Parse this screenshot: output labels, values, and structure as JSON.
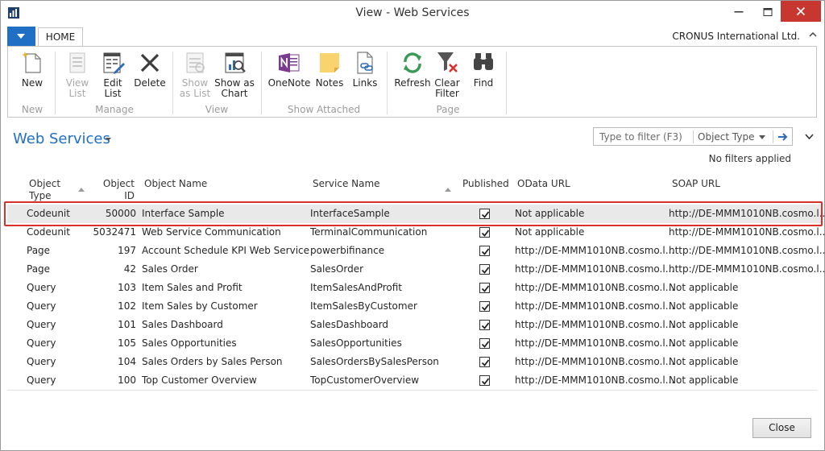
{
  "window": {
    "title": "View - Web Services"
  },
  "ribbon": {
    "tab": "HOME",
    "company": "CRONUS International Ltd.",
    "groups": [
      {
        "label": "New"
      },
      {
        "label": "Manage"
      },
      {
        "label": "View"
      },
      {
        "label": "Show Attached"
      },
      {
        "label": "Page"
      }
    ],
    "buttons": {
      "new": {
        "l1": "New",
        "l2": "",
        "icon": "new-document-icon"
      },
      "view_list": {
        "l1": "View",
        "l2": "List",
        "icon": "view-list-icon"
      },
      "edit_list": {
        "l1": "Edit",
        "l2": "List",
        "icon": "edit-list-icon"
      },
      "delete": {
        "l1": "Delete",
        "l2": "",
        "icon": "delete-x-icon"
      },
      "show_as_list": {
        "l1": "Show",
        "l2": "as List",
        "icon": "show-as-list-icon"
      },
      "show_as_chart": {
        "l1": "Show as",
        "l2": "Chart",
        "icon": "show-as-chart-icon"
      },
      "onenote": {
        "l1": "OneNote",
        "l2": "",
        "icon": "onenote-icon"
      },
      "notes": {
        "l1": "Notes",
        "l2": "",
        "icon": "notes-icon"
      },
      "links": {
        "l1": "Links",
        "l2": "",
        "icon": "links-icon"
      },
      "refresh": {
        "l1": "Refresh",
        "l2": "",
        "icon": "refresh-icon"
      },
      "clear_filter": {
        "l1": "Clear",
        "l2": "Filter",
        "icon": "clear-filter-icon"
      },
      "find": {
        "l1": "Find",
        "l2": "",
        "icon": "binoculars-icon"
      }
    }
  },
  "page": {
    "title": "Web Services",
    "filter_placeholder": "Type to filter (F3)",
    "filter_field": "Object Type",
    "filter_status": "No filters applied"
  },
  "table": {
    "columns": {
      "object_type": {
        "l1": "Object",
        "l2": "Type"
      },
      "object_id": {
        "l1": "Object",
        "l2": "ID"
      },
      "object_name": "Object Name",
      "service_name": "Service Name",
      "published": "Published",
      "odata_url": "OData URL",
      "soap_url": "SOAP URL"
    },
    "rows": [
      {
        "type": "Codeunit",
        "id": "50000",
        "name": "Interface Sample",
        "service": "InterfaceSample",
        "published": true,
        "odata": "Not applicable",
        "soap": "http://DE-MMM1010NB.cosmo.l..."
      },
      {
        "type": "Codeunit",
        "id": "5032471",
        "name": "Web Service Communication",
        "service": "TerminalCommunication",
        "published": true,
        "odata": "Not applicable",
        "soap": "http://DE-MMM1010NB.cosmo.l..."
      },
      {
        "type": "Page",
        "id": "197",
        "name": "Account Schedule KPI Web Service",
        "service": "powerbifinance",
        "published": true,
        "odata": "http://DE-MMM1010NB.cosmo.l...",
        "soap": "http://DE-MMM1010NB.cosmo.l..."
      },
      {
        "type": "Page",
        "id": "42",
        "name": "Sales Order",
        "service": "SalesOrder",
        "published": true,
        "odata": "http://DE-MMM1010NB.cosmo.l...",
        "soap": "http://DE-MMM1010NB.cosmo.l..."
      },
      {
        "type": "Query",
        "id": "103",
        "name": "Item Sales and Profit",
        "service": "ItemSalesAndProfit",
        "published": true,
        "odata": "http://DE-MMM1010NB.cosmo.l...",
        "soap": "Not applicable"
      },
      {
        "type": "Query",
        "id": "102",
        "name": "Item Sales by Customer",
        "service": "ItemSalesByCustomer",
        "published": true,
        "odata": "http://DE-MMM1010NB.cosmo.l...",
        "soap": "Not applicable"
      },
      {
        "type": "Query",
        "id": "101",
        "name": "Sales Dashboard",
        "service": "SalesDashboard",
        "published": true,
        "odata": "http://DE-MMM1010NB.cosmo.l...",
        "soap": "Not applicable"
      },
      {
        "type": "Query",
        "id": "105",
        "name": "Sales Opportunities",
        "service": "SalesOpportunities",
        "published": true,
        "odata": "http://DE-MMM1010NB.cosmo.l...",
        "soap": "Not applicable"
      },
      {
        "type": "Query",
        "id": "104",
        "name": "Sales Orders by Sales Person",
        "service": "SalesOrdersBySalesPerson",
        "published": true,
        "odata": "http://DE-MMM1010NB.cosmo.l...",
        "soap": "Not applicable"
      },
      {
        "type": "Query",
        "id": "100",
        "name": "Top Customer Overview",
        "service": "TopCustomerOverview",
        "published": true,
        "odata": "http://DE-MMM1010NB.cosmo.l...",
        "soap": "Not applicable"
      }
    ]
  },
  "footer": {
    "close_label": "Close"
  }
}
